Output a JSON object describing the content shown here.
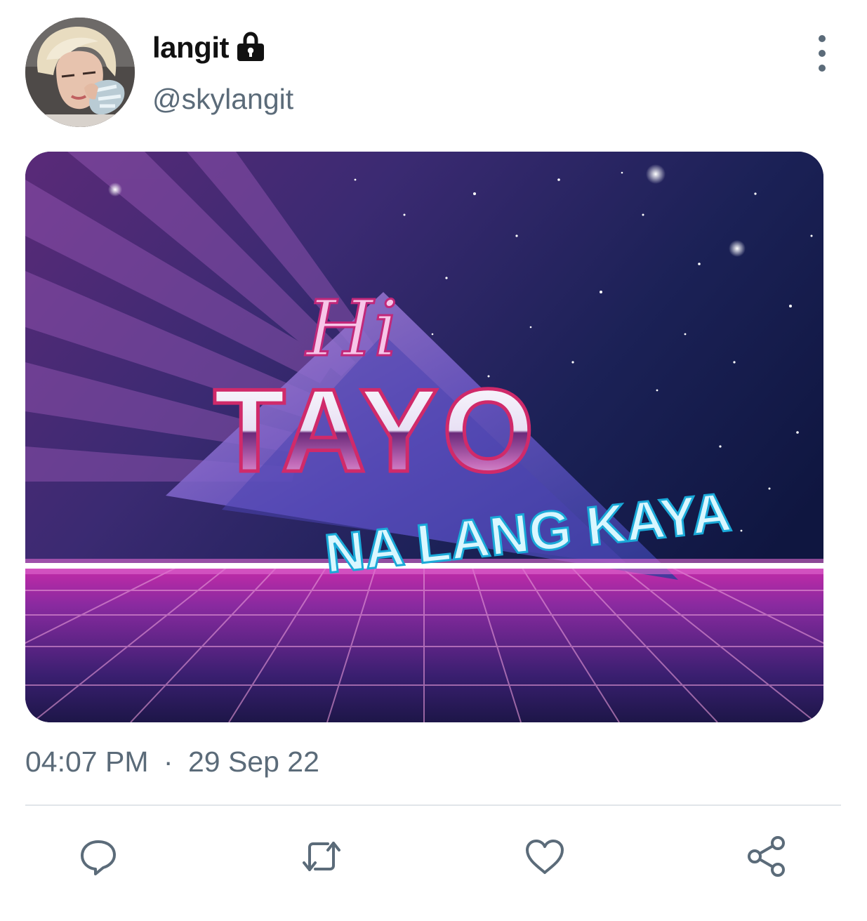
{
  "tweet": {
    "author": {
      "display_name": "langit",
      "handle": "@skylangit",
      "protected_icon": "lock-icon",
      "avatar": "avatar"
    },
    "menu_icon": "more-vertical-icon",
    "media": {
      "line1": "Hi",
      "line2": "TAYO",
      "line3": "NA LANG KAYA"
    },
    "time": "04:07 PM",
    "separator": "·",
    "date": "29 Sep 22",
    "actions": [
      {
        "name": "reply",
        "icon": "reply-icon"
      },
      {
        "name": "retweet",
        "icon": "retweet-icon"
      },
      {
        "name": "like",
        "icon": "heart-icon"
      },
      {
        "name": "share",
        "icon": "share-icon"
      }
    ],
    "colors": {
      "text_primary": "#111111",
      "text_secondary": "#5b6b79",
      "divider": "#e1e5e9",
      "icon": "#5b6b79"
    }
  }
}
